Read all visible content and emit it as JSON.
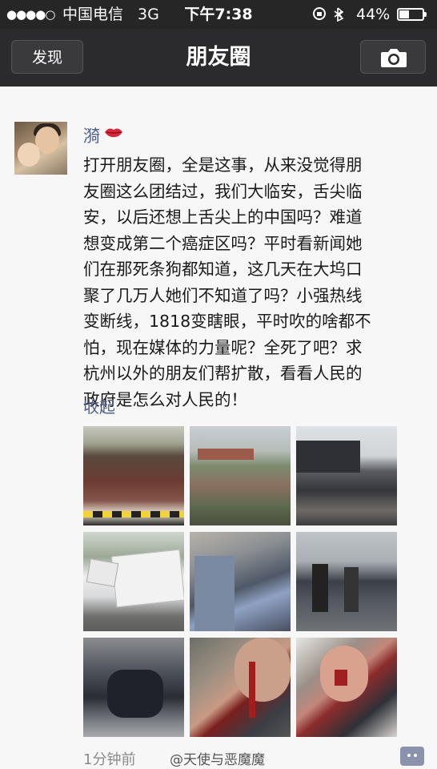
{
  "status_bar": {
    "signal": "●●●●○",
    "carrier": "中国电信",
    "network": "3G",
    "time": "下午7:38",
    "battery_percent": "44%",
    "battery_level": 0.44
  },
  "navbar": {
    "back_label": "发现",
    "title": "朋友圈"
  },
  "post": {
    "username": "漪",
    "text": "打开朋友圈，全是这事，从来没觉得朋\n友圈这么团结过，我们大临安，舌尖临\n安，以后还想上舌尖上的中国吗？难道\n想变成第二个癌症区吗？平时看新闻她\n们在那死条狗都知道，这几天在大坞口\n聚了几万人她们不知道了吗？小强热线\n变断线，1818变瞎眼，平时吹的啥都不\n怕，现在媒体的力量呢？全死了吧？求\n杭州以外的朋友们帮扩散，看看人民的\n政府是怎么对人民的！",
    "collapse_label": "收起",
    "timestamp": "1分钟前",
    "watermark": "@天使与恶魔魔"
  },
  "colors": {
    "nav_bg": "#2b2b2d",
    "link": "#52618f",
    "body_bg": "#f7f7f7"
  }
}
